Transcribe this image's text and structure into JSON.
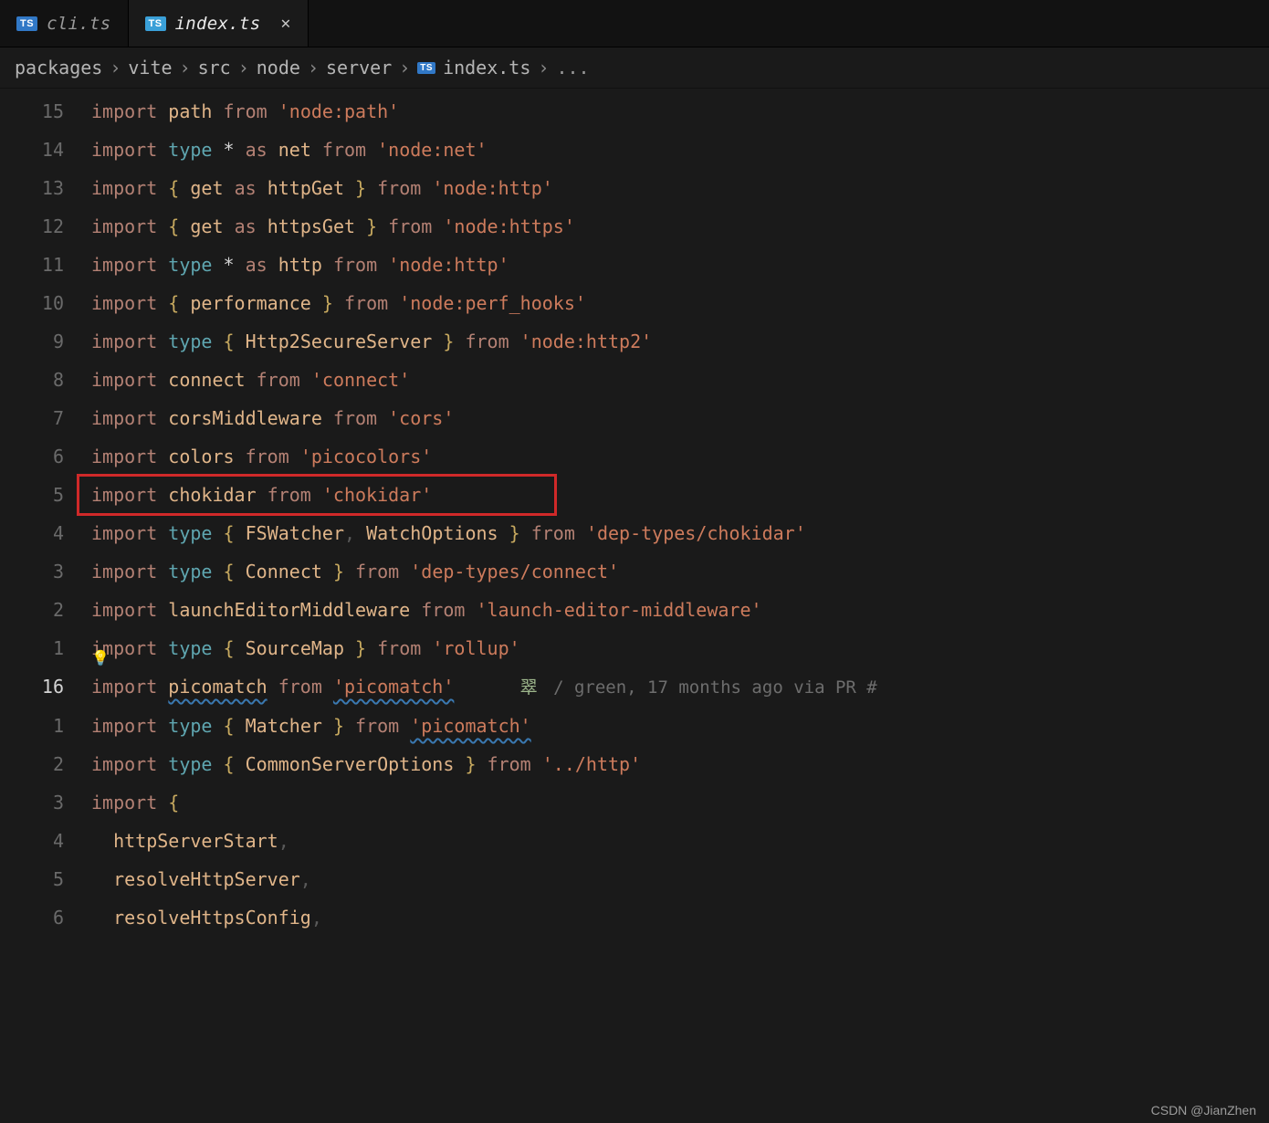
{
  "tabs": [
    {
      "badge": "TS",
      "name": "cli.ts",
      "active": false
    },
    {
      "badge": "TS",
      "name": "index.ts",
      "active": true
    }
  ],
  "breadcrumbs": {
    "parts": [
      "packages",
      "vite",
      "src",
      "node",
      "server"
    ],
    "file_badge": "TS",
    "file": "index.ts",
    "ellipsis": "..."
  },
  "highlight_line_index": 10,
  "codelens": {
    "char": "翠",
    "text": " / green, 17 months ago via PR #"
  },
  "wavy_tokens": [
    "picomatch"
  ],
  "watermark": "CSDN @JianZhen",
  "code": [
    {
      "num": "15",
      "t": [
        [
          "kw",
          "import"
        ],
        [
          "sp",
          " "
        ],
        [
          "id",
          "path"
        ],
        [
          "sp",
          " "
        ],
        [
          "fr",
          "from"
        ],
        [
          "sp",
          " "
        ],
        [
          "str",
          "'node:path'"
        ]
      ]
    },
    {
      "num": "14",
      "t": [
        [
          "kw",
          "import"
        ],
        [
          "sp",
          " "
        ],
        [
          "ty",
          "type"
        ],
        [
          "sp",
          " "
        ],
        [
          "star",
          "*"
        ],
        [
          "sp",
          " "
        ],
        [
          "as",
          "as"
        ],
        [
          "sp",
          " "
        ],
        [
          "id",
          "net"
        ],
        [
          "sp",
          " "
        ],
        [
          "fr",
          "from"
        ],
        [
          "sp",
          " "
        ],
        [
          "str",
          "'node:net'"
        ]
      ]
    },
    {
      "num": "13",
      "t": [
        [
          "kw",
          "import"
        ],
        [
          "sp",
          " "
        ],
        [
          "pn",
          "{"
        ],
        [
          "sp",
          " "
        ],
        [
          "id",
          "get"
        ],
        [
          "sp",
          " "
        ],
        [
          "as",
          "as"
        ],
        [
          "sp",
          " "
        ],
        [
          "id",
          "httpGet"
        ],
        [
          "sp",
          " "
        ],
        [
          "pn",
          "}"
        ],
        [
          "sp",
          " "
        ],
        [
          "fr",
          "from"
        ],
        [
          "sp",
          " "
        ],
        [
          "str",
          "'node:http'"
        ]
      ]
    },
    {
      "num": "12",
      "t": [
        [
          "kw",
          "import"
        ],
        [
          "sp",
          " "
        ],
        [
          "pn",
          "{"
        ],
        [
          "sp",
          " "
        ],
        [
          "id",
          "get"
        ],
        [
          "sp",
          " "
        ],
        [
          "as",
          "as"
        ],
        [
          "sp",
          " "
        ],
        [
          "id",
          "httpsGet"
        ],
        [
          "sp",
          " "
        ],
        [
          "pn",
          "}"
        ],
        [
          "sp",
          " "
        ],
        [
          "fr",
          "from"
        ],
        [
          "sp",
          " "
        ],
        [
          "str",
          "'node:https'"
        ]
      ]
    },
    {
      "num": "11",
      "t": [
        [
          "kw",
          "import"
        ],
        [
          "sp",
          " "
        ],
        [
          "ty",
          "type"
        ],
        [
          "sp",
          " "
        ],
        [
          "star",
          "*"
        ],
        [
          "sp",
          " "
        ],
        [
          "as",
          "as"
        ],
        [
          "sp",
          " "
        ],
        [
          "id",
          "http"
        ],
        [
          "sp",
          " "
        ],
        [
          "fr",
          "from"
        ],
        [
          "sp",
          " "
        ],
        [
          "str",
          "'node:http'"
        ]
      ]
    },
    {
      "num": "10",
      "t": [
        [
          "kw",
          "import"
        ],
        [
          "sp",
          " "
        ],
        [
          "pn",
          "{"
        ],
        [
          "sp",
          " "
        ],
        [
          "id",
          "performance"
        ],
        [
          "sp",
          " "
        ],
        [
          "pn",
          "}"
        ],
        [
          "sp",
          " "
        ],
        [
          "fr",
          "from"
        ],
        [
          "sp",
          " "
        ],
        [
          "str",
          "'node:perf_hooks'"
        ]
      ]
    },
    {
      "num": "9",
      "t": [
        [
          "kw",
          "import"
        ],
        [
          "sp",
          " "
        ],
        [
          "ty",
          "type"
        ],
        [
          "sp",
          " "
        ],
        [
          "pn",
          "{"
        ],
        [
          "sp",
          " "
        ],
        [
          "id",
          "Http2SecureServer"
        ],
        [
          "sp",
          " "
        ],
        [
          "pn",
          "}"
        ],
        [
          "sp",
          " "
        ],
        [
          "fr",
          "from"
        ],
        [
          "sp",
          " "
        ],
        [
          "str",
          "'node:http2'"
        ]
      ]
    },
    {
      "num": "8",
      "t": [
        [
          "kw",
          "import"
        ],
        [
          "sp",
          " "
        ],
        [
          "id",
          "connect"
        ],
        [
          "sp",
          " "
        ],
        [
          "fr",
          "from"
        ],
        [
          "sp",
          " "
        ],
        [
          "str",
          "'connect'"
        ]
      ]
    },
    {
      "num": "7",
      "t": [
        [
          "kw",
          "import"
        ],
        [
          "sp",
          " "
        ],
        [
          "id",
          "corsMiddleware"
        ],
        [
          "sp",
          " "
        ],
        [
          "fr",
          "from"
        ],
        [
          "sp",
          " "
        ],
        [
          "str",
          "'cors'"
        ]
      ]
    },
    {
      "num": "6",
      "t": [
        [
          "kw",
          "import"
        ],
        [
          "sp",
          " "
        ],
        [
          "id",
          "colors"
        ],
        [
          "sp",
          " "
        ],
        [
          "fr",
          "from"
        ],
        [
          "sp",
          " "
        ],
        [
          "str",
          "'picocolors'"
        ]
      ]
    },
    {
      "num": "5",
      "highlight": true,
      "t": [
        [
          "kw",
          "import"
        ],
        [
          "sp",
          " "
        ],
        [
          "id",
          "chokidar"
        ],
        [
          "sp",
          " "
        ],
        [
          "fr",
          "from"
        ],
        [
          "sp",
          " "
        ],
        [
          "str",
          "'chokidar'"
        ]
      ]
    },
    {
      "num": "4",
      "t": [
        [
          "kw",
          "import"
        ],
        [
          "sp",
          " "
        ],
        [
          "ty",
          "type"
        ],
        [
          "sp",
          " "
        ],
        [
          "pn",
          "{"
        ],
        [
          "sp",
          " "
        ],
        [
          "id",
          "FSWatcher"
        ],
        [
          "cm",
          ","
        ],
        [
          "sp",
          " "
        ],
        [
          "id",
          "WatchOptions"
        ],
        [
          "sp",
          " "
        ],
        [
          "pn",
          "}"
        ],
        [
          "sp",
          " "
        ],
        [
          "fr",
          "from"
        ],
        [
          "sp",
          " "
        ],
        [
          "str",
          "'dep-types/chokidar'"
        ]
      ]
    },
    {
      "num": "3",
      "t": [
        [
          "kw",
          "import"
        ],
        [
          "sp",
          " "
        ],
        [
          "ty",
          "type"
        ],
        [
          "sp",
          " "
        ],
        [
          "pn",
          "{"
        ],
        [
          "sp",
          " "
        ],
        [
          "id",
          "Connect"
        ],
        [
          "sp",
          " "
        ],
        [
          "pn",
          "}"
        ],
        [
          "sp",
          " "
        ],
        [
          "fr",
          "from"
        ],
        [
          "sp",
          " "
        ],
        [
          "str",
          "'dep-types/connect'"
        ]
      ]
    },
    {
      "num": "2",
      "t": [
        [
          "kw",
          "import"
        ],
        [
          "sp",
          " "
        ],
        [
          "id",
          "launchEditorMiddleware"
        ],
        [
          "sp",
          " "
        ],
        [
          "fr",
          "from"
        ],
        [
          "sp",
          " "
        ],
        [
          "str",
          "'launch-editor-middleware'"
        ]
      ]
    },
    {
      "num": "1",
      "bulb": true,
      "t": [
        [
          "kw",
          "import"
        ],
        [
          "sp",
          " "
        ],
        [
          "ty",
          "type"
        ],
        [
          "sp",
          " "
        ],
        [
          "pn",
          "{"
        ],
        [
          "sp",
          " "
        ],
        [
          "id",
          "SourceMap"
        ],
        [
          "sp",
          " "
        ],
        [
          "pn",
          "}"
        ],
        [
          "sp",
          " "
        ],
        [
          "fr",
          "from"
        ],
        [
          "sp",
          " "
        ],
        [
          "str",
          "'rollup'"
        ]
      ]
    },
    {
      "num": "16",
      "current": true,
      "codelens": true,
      "t": [
        [
          "kw",
          "import"
        ],
        [
          "sp",
          " "
        ],
        [
          "id",
          "picomatch"
        ],
        [
          "sp",
          " "
        ],
        [
          "fr",
          "from"
        ],
        [
          "sp",
          " "
        ],
        [
          "str",
          "'picomatch'"
        ]
      ]
    },
    {
      "num": "1",
      "t": [
        [
          "kw",
          "import"
        ],
        [
          "sp",
          " "
        ],
        [
          "ty",
          "type"
        ],
        [
          "sp",
          " "
        ],
        [
          "pn",
          "{"
        ],
        [
          "sp",
          " "
        ],
        [
          "id",
          "Matcher"
        ],
        [
          "sp",
          " "
        ],
        [
          "pn",
          "}"
        ],
        [
          "sp",
          " "
        ],
        [
          "fr",
          "from"
        ],
        [
          "sp",
          " "
        ],
        [
          "str",
          "'picomatch'"
        ]
      ]
    },
    {
      "num": "2",
      "t": [
        [
          "kw",
          "import"
        ],
        [
          "sp",
          " "
        ],
        [
          "ty",
          "type"
        ],
        [
          "sp",
          " "
        ],
        [
          "pn",
          "{"
        ],
        [
          "sp",
          " "
        ],
        [
          "id",
          "CommonServerOptions"
        ],
        [
          "sp",
          " "
        ],
        [
          "pn",
          "}"
        ],
        [
          "sp",
          " "
        ],
        [
          "fr",
          "from"
        ],
        [
          "sp",
          " "
        ],
        [
          "str",
          "'../http'"
        ]
      ]
    },
    {
      "num": "3",
      "t": [
        [
          "kw",
          "import"
        ],
        [
          "sp",
          " "
        ],
        [
          "pn",
          "{"
        ]
      ]
    },
    {
      "num": "4",
      "t": [
        [
          "guide",
          "  "
        ],
        [
          "id",
          "httpServerStart"
        ],
        [
          "cm",
          ","
        ]
      ]
    },
    {
      "num": "5",
      "t": [
        [
          "guide",
          "  "
        ],
        [
          "id",
          "resolveHttpServer"
        ],
        [
          "cm",
          ","
        ]
      ]
    },
    {
      "num": "6",
      "t": [
        [
          "guide",
          "  "
        ],
        [
          "id",
          "resolveHttpsConfig"
        ],
        [
          "cm",
          ","
        ]
      ]
    }
  ]
}
